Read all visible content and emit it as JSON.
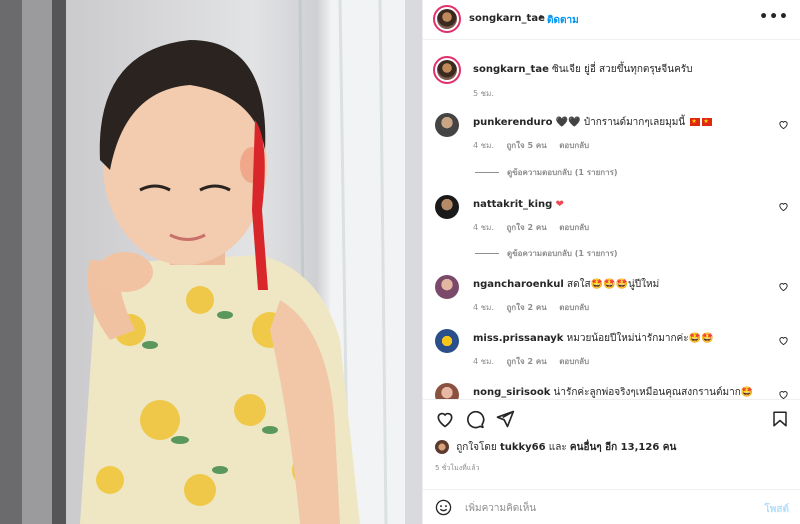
{
  "post": {
    "author": "songkarn_tae",
    "follow_label": "ติดตาม",
    "more_label": "•••",
    "dot": "•"
  },
  "caption": {
    "username": "songkarn_tae",
    "text": "ซินเจีย ยู่อี่ สวยขึ้นทุกตรุษจีนครับ",
    "time": "5 ชม."
  },
  "comments": [
    {
      "username": "punkerenduro",
      "text": "🖤🖤 ป๋ากรานด์มากๆเลยมุมนี้",
      "flags": 2,
      "time": "4 ชม.",
      "likes": "ถูกใจ 5 คน",
      "reply": "ตอบกลับ",
      "view_replies": "ดูข้อความตอบกลับ (1 รายการ)"
    },
    {
      "username": "nattakrit_king",
      "text": "❤",
      "time": "4 ชม.",
      "likes": "ถูกใจ 2 คน",
      "reply": "ตอบกลับ",
      "view_replies": "ดูข้อความตอบกลับ (1 รายการ)"
    },
    {
      "username": "ngancharoenkul",
      "text": "สดใส🤩🤩🤩นู่ปีใหม่",
      "time": "4 ชม.",
      "likes": "ถูกใจ 2 คน",
      "reply": "ตอบกลับ"
    },
    {
      "username": "miss.prissanayk",
      "text": "หมวยน้อยปีใหม่น่ารักมากค่ะ🤩🤩",
      "time": "4 ชม.",
      "likes": "ถูกใจ 2 คน",
      "reply": "ตอบกลับ"
    },
    {
      "username": "nong_sirisook",
      "text": "น่ารักค่ะลูกพ่อจริงๆเหมือนคุณสงกรานต์มาก🤩"
    }
  ],
  "likes_line": {
    "prefix": "ถูกใจโดย",
    "user": "tukky66",
    "and": "และ",
    "others": "คนอื่นๆ อีก 13,126 คน"
  },
  "time_ago": "5 ชั่วโมงที่แล้ว",
  "add_comment": {
    "placeholder": "เพิ่มความคิดเห็น",
    "post_label": "โพสต์"
  },
  "colors": {
    "accent": "#0095f6",
    "post_disabled": "#b2dffc",
    "meta": "#8e8e8e",
    "divider": "#efefef"
  }
}
